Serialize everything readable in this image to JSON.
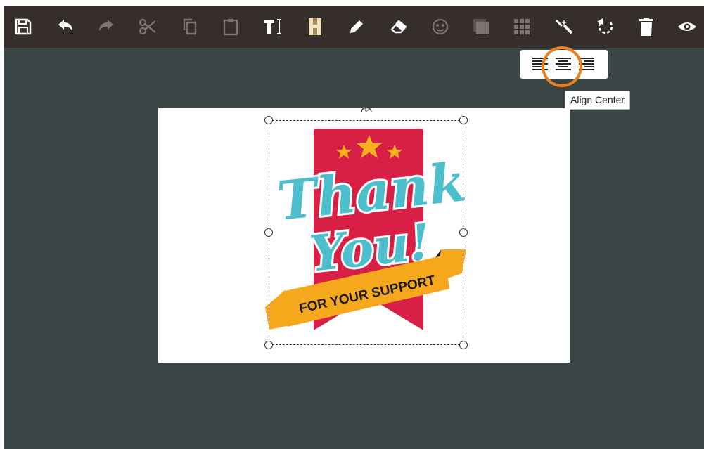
{
  "toolbar": {
    "buttons": [
      {
        "name": "save-button",
        "icon": "save-icon"
      },
      {
        "name": "undo-button",
        "icon": "undo-icon"
      },
      {
        "name": "redo-button",
        "icon": "redo-icon"
      },
      {
        "name": "cut-button",
        "icon": "scissors-icon"
      },
      {
        "name": "copy-button",
        "icon": "copy-icon"
      },
      {
        "name": "paste-button",
        "icon": "clipboard-icon"
      },
      {
        "name": "add-text-button",
        "icon": "text-cursor-icon"
      },
      {
        "name": "add-heading-button",
        "icon": "heading-icon"
      },
      {
        "name": "draw-button",
        "icon": "pencil-icon"
      },
      {
        "name": "eraser-button",
        "icon": "eraser-icon"
      },
      {
        "name": "face-button",
        "icon": "face-icon"
      },
      {
        "name": "layers-button",
        "icon": "layers-icon"
      },
      {
        "name": "grid-button",
        "icon": "grid-icon"
      },
      {
        "name": "magic-button",
        "icon": "magic-wand-icon"
      },
      {
        "name": "rotate-button",
        "icon": "rotate-icon"
      },
      {
        "name": "delete-button",
        "icon": "trash-icon"
      },
      {
        "name": "preview-button",
        "icon": "eye-icon"
      }
    ]
  },
  "align_popup": {
    "options": [
      "align-left-icon",
      "align-center-icon",
      "align-right-icon"
    ],
    "active": "align-center-icon"
  },
  "tooltip": {
    "text": "Align Center"
  },
  "artwork": {
    "line1": "Thank",
    "line2": "You!",
    "ribbon_text": "FOR YOUR SUPPORT"
  },
  "colors": {
    "toolbar_bg": "#362e2a",
    "workspace_bg": "#3a4546",
    "highlight_ring": "#ea7f1c",
    "banner_red": "#d81f45",
    "star_yellow": "#f6b11f",
    "lettering_teal": "#4dbfcc",
    "ribbon_orange": "#f5a81c"
  }
}
